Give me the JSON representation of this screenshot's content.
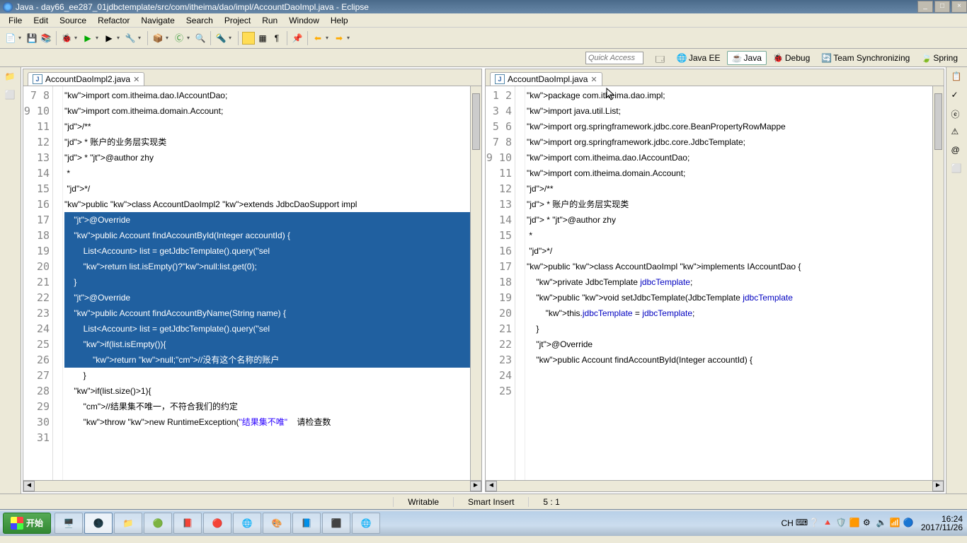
{
  "window": {
    "title": "Java - day66_ee287_01jdbctemplate/src/com/itheima/dao/impl/AccountDaoImpl.java - Eclipse"
  },
  "menu": {
    "items": [
      "File",
      "Edit",
      "Source",
      "Refactor",
      "Navigate",
      "Search",
      "Project",
      "Run",
      "Window",
      "Help"
    ]
  },
  "quickaccess": {
    "placeholder": "Quick Access"
  },
  "perspectives": {
    "items": [
      {
        "label": "Java EE",
        "active": false
      },
      {
        "label": "Java",
        "active": true
      },
      {
        "label": "Debug",
        "active": false
      },
      {
        "label": "Team Synchronizing",
        "active": false
      },
      {
        "label": "Spring",
        "active": false
      }
    ]
  },
  "editor_left": {
    "tab": "AccountDaoImpl2.java",
    "first_line": 7,
    "lines": [
      "",
      "import com.itheima.dao.IAccountDao;",
      "import com.itheima.domain.Account;",
      "/**",
      " * 账户的业务层实现类",
      " * @author zhy",
      " *",
      " */",
      "public class AccountDaoImpl2 extends JdbcDaoSupport impl",
      "",
      "    @Override",
      "    public Account findAccountById(Integer accountId) {",
      "        List<Account> list = getJdbcTemplate().query(\"sel",
      "        return list.isEmpty()?null:list.get(0);",
      "    }",
      "",
      "    @Override",
      "    public Account findAccountByName(String name) {",
      "        List<Account> list = getJdbcTemplate().query(\"sel",
      "        if(list.isEmpty()){",
      "            return null;//没有这个名称的账户",
      "        }",
      "    if(list.size()>1){",
      "        //结果集不唯一，不符合我们的约定",
      "        throw new RuntimeException(\"结果集不唯\"    请检查数"
    ],
    "sel_start": 17,
    "sel_end": 27
  },
  "editor_right": {
    "tab": "AccountDaoImpl.java",
    "first_line": 1,
    "lines": [
      "package com.itheima.dao.impl;",
      "",
      "import java.util.List;",
      "",
      "import org.springframework.jdbc.core.BeanPropertyRowMappe",
      "import org.springframework.jdbc.core.JdbcTemplate;",
      "",
      "import com.itheima.dao.IAccountDao;",
      "import com.itheima.domain.Account;",
      "/**",
      " * 账户的业务层实现类",
      " * @author zhy",
      " *",
      " */",
      "public class AccountDaoImpl implements IAccountDao {",
      "",
      "",
      "    private JdbcTemplate jdbcTemplate;",
      "",
      "    public void setJdbcTemplate(JdbcTemplate jdbcTemplate",
      "        this.jdbcTemplate = jdbcTemplate;",
      "    }",
      "",
      "    @Override",
      "    public Account findAccountById(Integer accountId) {"
    ]
  },
  "status": {
    "writable": "Writable",
    "insert": "Smart Insert",
    "pos": "5 : 1"
  },
  "taskbar": {
    "start": "开始",
    "ime": "CH",
    "time": "16:24",
    "date": "2017/11/26"
  }
}
